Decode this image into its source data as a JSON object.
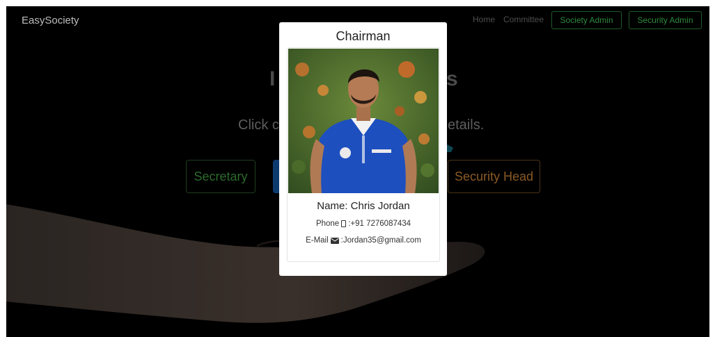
{
  "navbar": {
    "brand": "EasySociety",
    "links": {
      "home": "Home",
      "committee": "Committee"
    },
    "buttons": {
      "society_admin": "Society Admin",
      "security_admin": "Security Admin"
    },
    "accent_color": "#2f8a3e"
  },
  "background": {
    "heading_visible_left": "I",
    "heading_visible_right": "s",
    "subtitle_left": "Click c",
    "subtitle_right": "etails.",
    "roles": {
      "secretary": "Secretary",
      "security_head": "Security Head"
    }
  },
  "modal": {
    "title": "Chairman",
    "name": "Name: Chris Jordan",
    "phone_label": "Phone",
    "phone_value": ":+91 7276087434",
    "email_label": "E-Mail",
    "email_value": ":Jordan35@gmail.com",
    "icons": {
      "phone": "phone-icon",
      "email": "envelope-icon"
    }
  }
}
